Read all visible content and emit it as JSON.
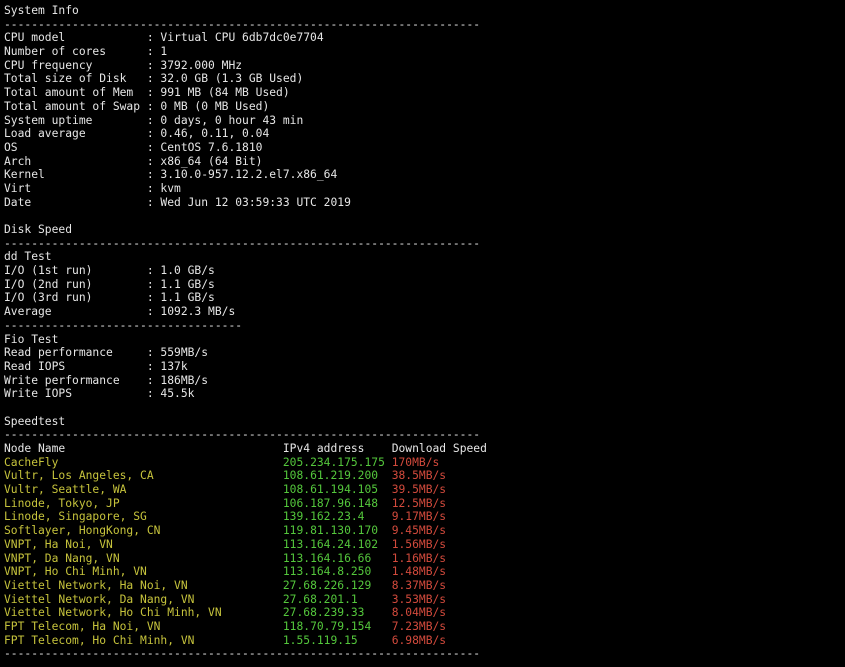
{
  "colors": {
    "background": "#000000",
    "text": "#e6e6e6",
    "yellow": "#c6c33c",
    "green": "#54c73c",
    "red": "#d24a3c"
  },
  "lines": [
    {
      "kind": "text",
      "text": "System Info"
    },
    {
      "kind": "text",
      "text": "----------------------------------------------------------------------"
    },
    {
      "kind": "text",
      "text": "CPU model            : Virtual CPU 6db7dc0e7704"
    },
    {
      "kind": "text",
      "text": "Number of cores      : 1"
    },
    {
      "kind": "text",
      "text": "CPU frequency        : 3792.000 MHz"
    },
    {
      "kind": "text",
      "text": "Total size of Disk   : 32.0 GB (1.3 GB Used)"
    },
    {
      "kind": "text",
      "text": "Total amount of Mem  : 991 MB (84 MB Used)"
    },
    {
      "kind": "text",
      "text": "Total amount of Swap : 0 MB (0 MB Used)"
    },
    {
      "kind": "text",
      "text": "System uptime        : 0 days, 0 hour 43 min"
    },
    {
      "kind": "text",
      "text": "Load average         : 0.46, 0.11, 0.04"
    },
    {
      "kind": "text",
      "text": "OS                   : CentOS 7.6.1810"
    },
    {
      "kind": "text",
      "text": "Arch                 : x86_64 (64 Bit)"
    },
    {
      "kind": "text",
      "text": "Kernel               : 3.10.0-957.12.2.el7.x86_64"
    },
    {
      "kind": "text",
      "text": "Virt                 : kvm"
    },
    {
      "kind": "text",
      "text": "Date                 : Wed Jun 12 03:59:33 UTC 2019"
    },
    {
      "kind": "text",
      "text": ""
    },
    {
      "kind": "text",
      "text": "Disk Speed"
    },
    {
      "kind": "text",
      "text": "----------------------------------------------------------------------"
    },
    {
      "kind": "text",
      "text": "dd Test"
    },
    {
      "kind": "text",
      "text": "I/O (1st run)        : 1.0 GB/s"
    },
    {
      "kind": "text",
      "text": "I/O (2nd run)        : 1.1 GB/s"
    },
    {
      "kind": "text",
      "text": "I/O (3rd run)        : 1.1 GB/s"
    },
    {
      "kind": "text",
      "text": "Average              : 1092.3 MB/s"
    },
    {
      "kind": "text",
      "text": "-----------------------------------"
    },
    {
      "kind": "text",
      "text": "Fio Test"
    },
    {
      "kind": "text",
      "text": "Read performance     : 559MB/s"
    },
    {
      "kind": "text",
      "text": "Read IOPS            : 137k"
    },
    {
      "kind": "text",
      "text": "Write performance    : 186MB/s"
    },
    {
      "kind": "text",
      "text": "Write IOPS           : 45.5k"
    },
    {
      "kind": "text",
      "text": ""
    },
    {
      "kind": "text",
      "text": "Speedtest"
    },
    {
      "kind": "text",
      "text": "----------------------------------------------------------------------"
    },
    {
      "kind": "header",
      "node": "Node Name",
      "ip": "IPv4 address",
      "speed": "Download Speed"
    },
    {
      "kind": "row",
      "node": "CacheFly",
      "ip": "205.234.175.175",
      "speed": "170MB/s"
    },
    {
      "kind": "row",
      "node": "Vultr, Los Angeles, CA",
      "ip": "108.61.219.200",
      "speed": "38.5MB/s"
    },
    {
      "kind": "row",
      "node": "Vultr, Seattle, WA",
      "ip": "108.61.194.105",
      "speed": "39.5MB/s"
    },
    {
      "kind": "row",
      "node": "Linode, Tokyo, JP",
      "ip": "106.187.96.148",
      "speed": "12.5MB/s"
    },
    {
      "kind": "row",
      "node": "Linode, Singapore, SG",
      "ip": "139.162.23.4",
      "speed": "9.17MB/s"
    },
    {
      "kind": "row",
      "node": "Softlayer, HongKong, CN",
      "ip": "119.81.130.170",
      "speed": "9.45MB/s"
    },
    {
      "kind": "row",
      "node": "VNPT, Ha Noi, VN",
      "ip": "113.164.24.102",
      "speed": "1.56MB/s"
    },
    {
      "kind": "row",
      "node": "VNPT, Da Nang, VN",
      "ip": "113.164.16.66",
      "speed": "1.16MB/s"
    },
    {
      "kind": "row",
      "node": "VNPT, Ho Chi Minh, VN",
      "ip": "113.164.8.250",
      "speed": "1.48MB/s"
    },
    {
      "kind": "row",
      "node": "Viettel Network, Ha Noi, VN",
      "ip": "27.68.226.129",
      "speed": "8.37MB/s"
    },
    {
      "kind": "row",
      "node": "Viettel Network, Da Nang, VN",
      "ip": "27.68.201.1",
      "speed": "3.53MB/s"
    },
    {
      "kind": "row",
      "node": "Viettel Network, Ho Chi Minh, VN",
      "ip": "27.68.239.33",
      "speed": "8.04MB/s"
    },
    {
      "kind": "row",
      "node": "FPT Telecom, Ha Noi, VN",
      "ip": "118.70.79.154",
      "speed": "7.23MB/s"
    },
    {
      "kind": "row",
      "node": "FPT Telecom, Ho Chi Minh, VN",
      "ip": "1.55.119.15",
      "speed": "6.98MB/s"
    },
    {
      "kind": "text",
      "text": "----------------------------------------------------------------------"
    }
  ]
}
